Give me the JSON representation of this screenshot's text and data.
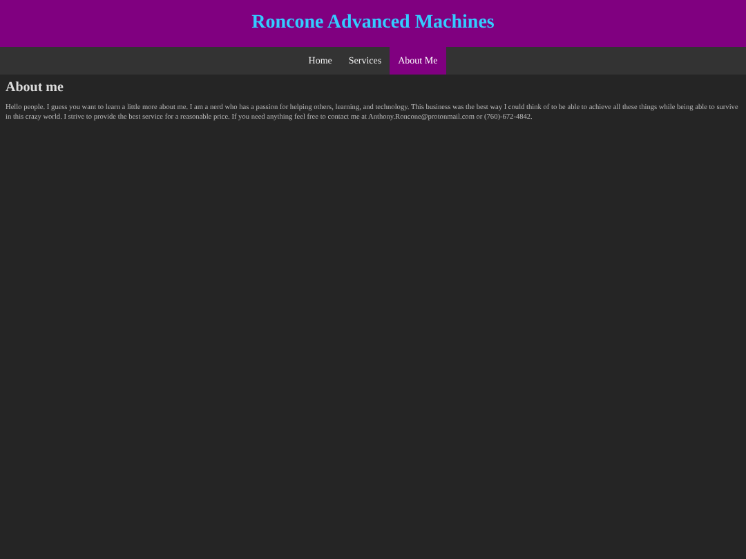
{
  "header": {
    "title": "Roncone Advanced Machines"
  },
  "nav": [
    {
      "label": "Home",
      "selected": false
    },
    {
      "label": "Services",
      "selected": false
    },
    {
      "label": "About Me",
      "selected": true
    }
  ],
  "section": {
    "heading": "About me",
    "text": "Hello people. I guess you want to learn a little more about me. I am a nerd who has a passion for helping others, learning, and technology. This business was the best way I could think of to be able to achieve all these things while being able to survive in this crazy world. I strive to provide the best service for a reasonable price. If you need anything feel free to contact me at Anthony.Roncone@protonmail.com or (760)-672-4842."
  }
}
